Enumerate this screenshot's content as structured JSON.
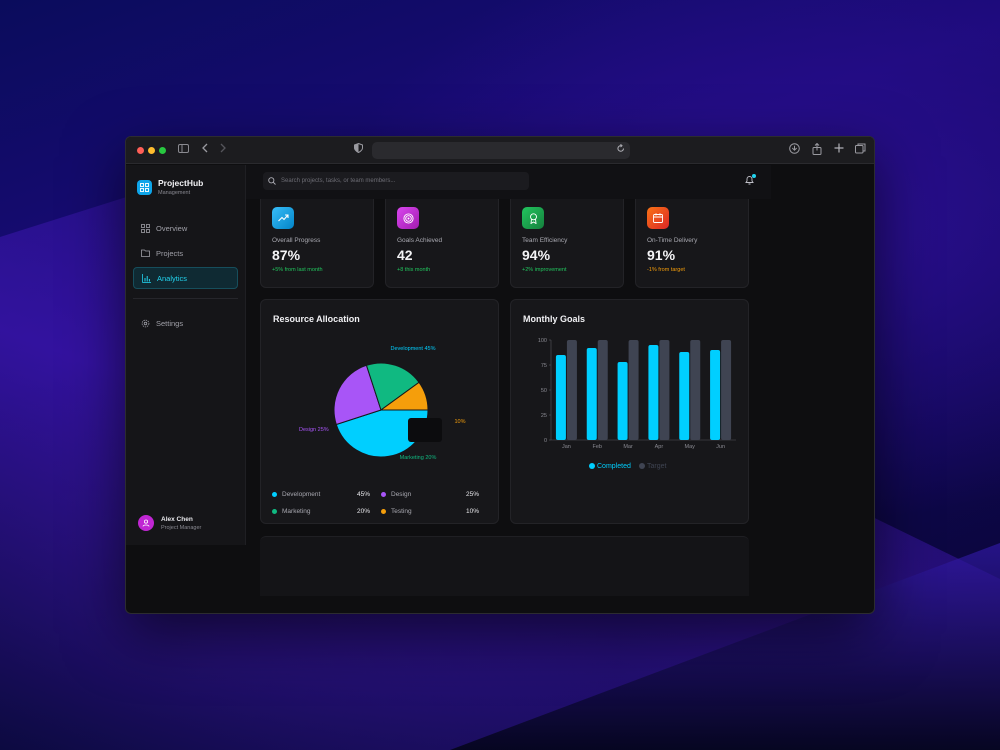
{
  "brand": {
    "name": "ProjectHub",
    "subtitle": "Management"
  },
  "search": {
    "placeholder": "Search projects, tasks, or team members..."
  },
  "nav": {
    "items": [
      {
        "label": "Overview",
        "icon": "grid-icon"
      },
      {
        "label": "Projects",
        "icon": "folder-icon"
      },
      {
        "label": "Analytics",
        "icon": "bar-chart-icon",
        "active": true
      }
    ],
    "settings": "Settings"
  },
  "user": {
    "name": "Alex Chen",
    "role": "Project Manager"
  },
  "stats": [
    {
      "label": "Overall Progress",
      "value": "87%",
      "change": "+5% from last month",
      "icon": "trending-up-icon",
      "color": "#0ea5e9",
      "change_color": "#22c55e"
    },
    {
      "label": "Goals Achieved",
      "value": "42",
      "change": "+8 this month",
      "icon": "target-icon",
      "color": "#c026d3",
      "change_color": "#22c55e"
    },
    {
      "label": "Team Efficiency",
      "value": "94%",
      "change": "+2% improvement",
      "icon": "award-icon",
      "color": "#16a34a",
      "change_color": "#22c55e"
    },
    {
      "label": "On-Time Delivery",
      "value": "91%",
      "change": "-1% from target",
      "icon": "calendar-icon",
      "color": "#ea580c",
      "change_color": "#f59e0b"
    }
  ],
  "resource": {
    "title": "Resource Allocation",
    "legend": [
      {
        "name": "Development",
        "pct": "45%",
        "color": "#00cfff"
      },
      {
        "name": "Design",
        "pct": "25%",
        "color": "#a855f7"
      },
      {
        "name": "Marketing",
        "pct": "20%",
        "color": "#10b981"
      },
      {
        "name": "Testing",
        "pct": "10%",
        "color": "#f59e0b"
      }
    ]
  },
  "monthly": {
    "title": "Monthly Goals"
  },
  "chart_data": [
    {
      "type": "pie",
      "title": "Resource Allocation",
      "labels": [
        "Development",
        "Design",
        "Marketing",
        "Testing"
      ],
      "values": [
        45,
        25,
        20,
        10
      ],
      "slice_labels": [
        "Development 45%",
        "Design 25%",
        "Marketing 20%",
        "10%"
      ],
      "colors": [
        "#00cfff",
        "#a855f7",
        "#10b981",
        "#f59e0b"
      ]
    },
    {
      "type": "bar",
      "title": "Monthly Goals",
      "categories": [
        "Jan",
        "Feb",
        "Mar",
        "Apr",
        "May",
        "Jun"
      ],
      "series": [
        {
          "name": "Completed",
          "values": [
            85,
            92,
            78,
            95,
            88,
            90
          ],
          "color": "#00cfff"
        },
        {
          "name": "Target",
          "values": [
            100,
            100,
            100,
            100,
            100,
            100
          ],
          "color": "#3f4452"
        }
      ],
      "ylim": [
        0,
        100
      ],
      "yticks": [
        0,
        25,
        50,
        75,
        100
      ],
      "legend": "bottom"
    }
  ]
}
